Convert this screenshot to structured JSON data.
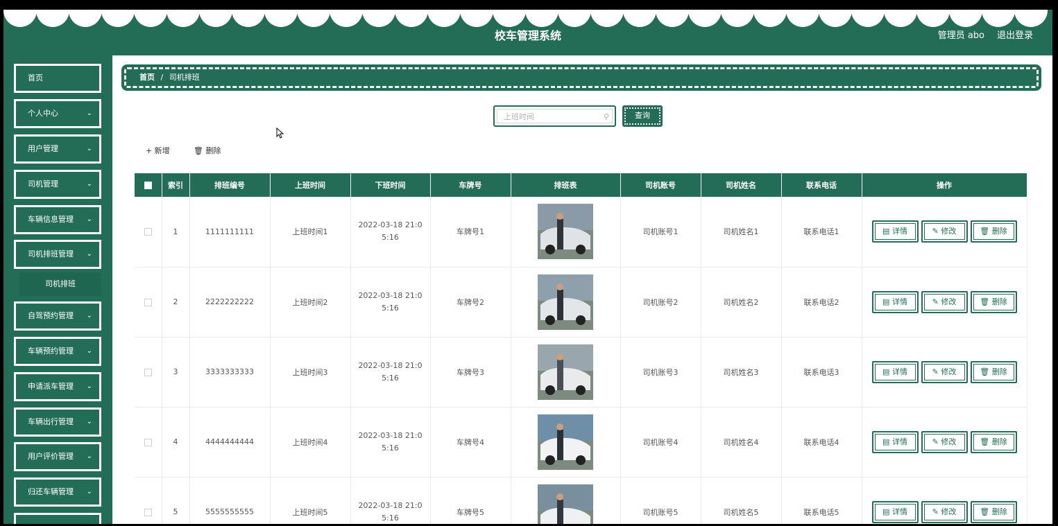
{
  "app": {
    "title": "校车管理系统",
    "user": "管理员 abo",
    "logout": "退出登录"
  },
  "sidebar": {
    "items": [
      {
        "label": "首页",
        "chevron": false
      },
      {
        "label": "个人中心",
        "chevron": true
      },
      {
        "label": "用户管理",
        "chevron": true
      },
      {
        "label": "司机管理",
        "chevron": true
      },
      {
        "label": "车辆信息管理",
        "chevron": true
      },
      {
        "label": "司机排班管理",
        "chevron": true
      },
      {
        "label": "自驾预约管理",
        "chevron": true
      },
      {
        "label": "车辆预约管理",
        "chevron": true
      },
      {
        "label": "申请派车管理",
        "chevron": true
      },
      {
        "label": "车辆出行管理",
        "chevron": true
      },
      {
        "label": "用户评价管理",
        "chevron": true
      },
      {
        "label": "归还车辆管理",
        "chevron": true
      }
    ],
    "submenu": {
      "label": "司机排班"
    }
  },
  "breadcrumb": {
    "home": "首页",
    "separator": "/",
    "current": "司机排班"
  },
  "search": {
    "placeholder": "上班时间",
    "button": "查询"
  },
  "toolbar": {
    "add": "新增",
    "delete": "删除"
  },
  "table": {
    "headers": [
      "索引",
      "排班编号",
      "上班时间",
      "下班时间",
      "车牌号",
      "排班表",
      "司机账号",
      "司机姓名",
      "联系电话",
      "操作"
    ],
    "rows": [
      {
        "index": "1",
        "code": "1111111111",
        "start": "上班时间1",
        "end": "2022-03-18 21:05:16",
        "plate": "车牌号1",
        "account": "司机账号1",
        "name": "司机姓名1",
        "phone": "联系电话1"
      },
      {
        "index": "2",
        "code": "2222222222",
        "start": "上班时间2",
        "end": "2022-03-18 21:05:16",
        "plate": "车牌号2",
        "account": "司机账号2",
        "name": "司机姓名2",
        "phone": "联系电话2"
      },
      {
        "index": "3",
        "code": "3333333333",
        "start": "上班时间3",
        "end": "2022-03-18 21:05:16",
        "plate": "车牌号3",
        "account": "司机账号3",
        "name": "司机姓名3",
        "phone": "联系电话3"
      },
      {
        "index": "4",
        "code": "4444444444",
        "start": "上班时间4",
        "end": "2022-03-18 21:05:16",
        "plate": "车牌号4",
        "account": "司机账号4",
        "name": "司机姓名4",
        "phone": "联系电话4"
      },
      {
        "index": "5",
        "code": "5555555555",
        "start": "上班时间5",
        "end": "2022-03-18 21:05:16",
        "plate": "车牌号5",
        "account": "司机账号5",
        "name": "司机姓名5",
        "phone": "联系电话5"
      }
    ],
    "actions": {
      "detail": "详情",
      "edit": "修改",
      "delete": "删除"
    }
  },
  "colors": {
    "primary": "#236c55",
    "border": "#eaeaea"
  },
  "icons": {
    "search": "magnifier-icon",
    "add": "plus-icon",
    "delete": "trash-icon",
    "detail": "document-icon",
    "edit": "pencil-icon",
    "chevron": "chevron-down-icon"
  }
}
